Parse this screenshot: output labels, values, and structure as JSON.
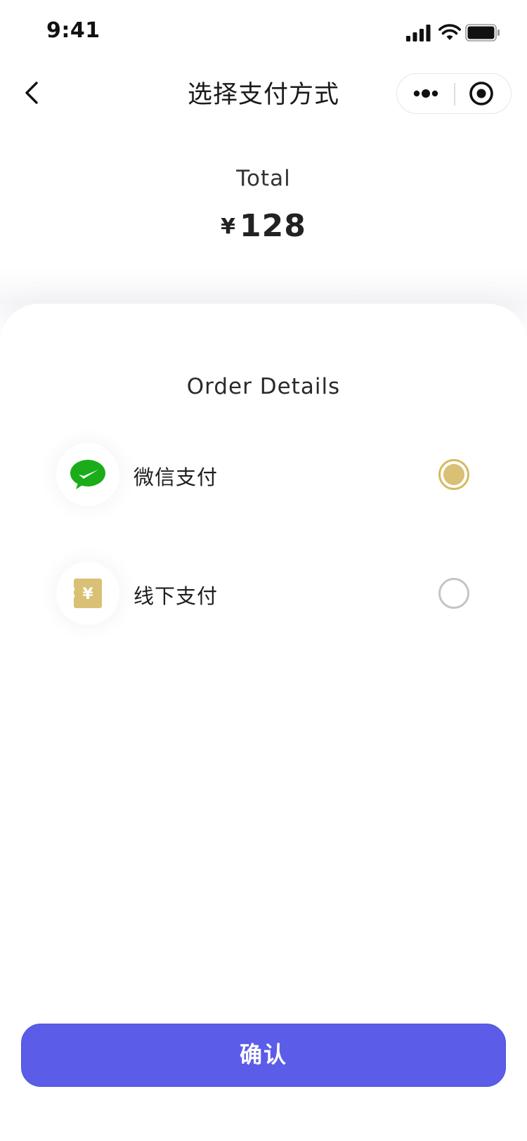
{
  "status_bar": {
    "time": "9:41",
    "signal_icon": "signal-bars-icon",
    "wifi_icon": "wifi-icon",
    "battery_icon": "battery-full-icon"
  },
  "nav": {
    "back_icon": "chevron-left-icon",
    "title": "选择支付方式",
    "capsule": {
      "more_icon": "more-dots-icon",
      "close_icon": "target-circle-icon"
    }
  },
  "summary": {
    "total_label": "Total",
    "currency": "¥",
    "amount": "128"
  },
  "order": {
    "title": "Order Details",
    "payment_options": [
      {
        "label": "微信支付",
        "icon": "wechat-pay-icon",
        "selected": true,
        "icon_color": "#1aad19"
      },
      {
        "label": "线下支付",
        "icon": "cash-ticket-icon",
        "selected": false,
        "icon_color": "#d8c074"
      }
    ]
  },
  "colors": {
    "accent": "#5b5de8",
    "radio_selected": "#d8c074",
    "radio_unselected": "#c4c4c4"
  },
  "confirm_label": "确认"
}
